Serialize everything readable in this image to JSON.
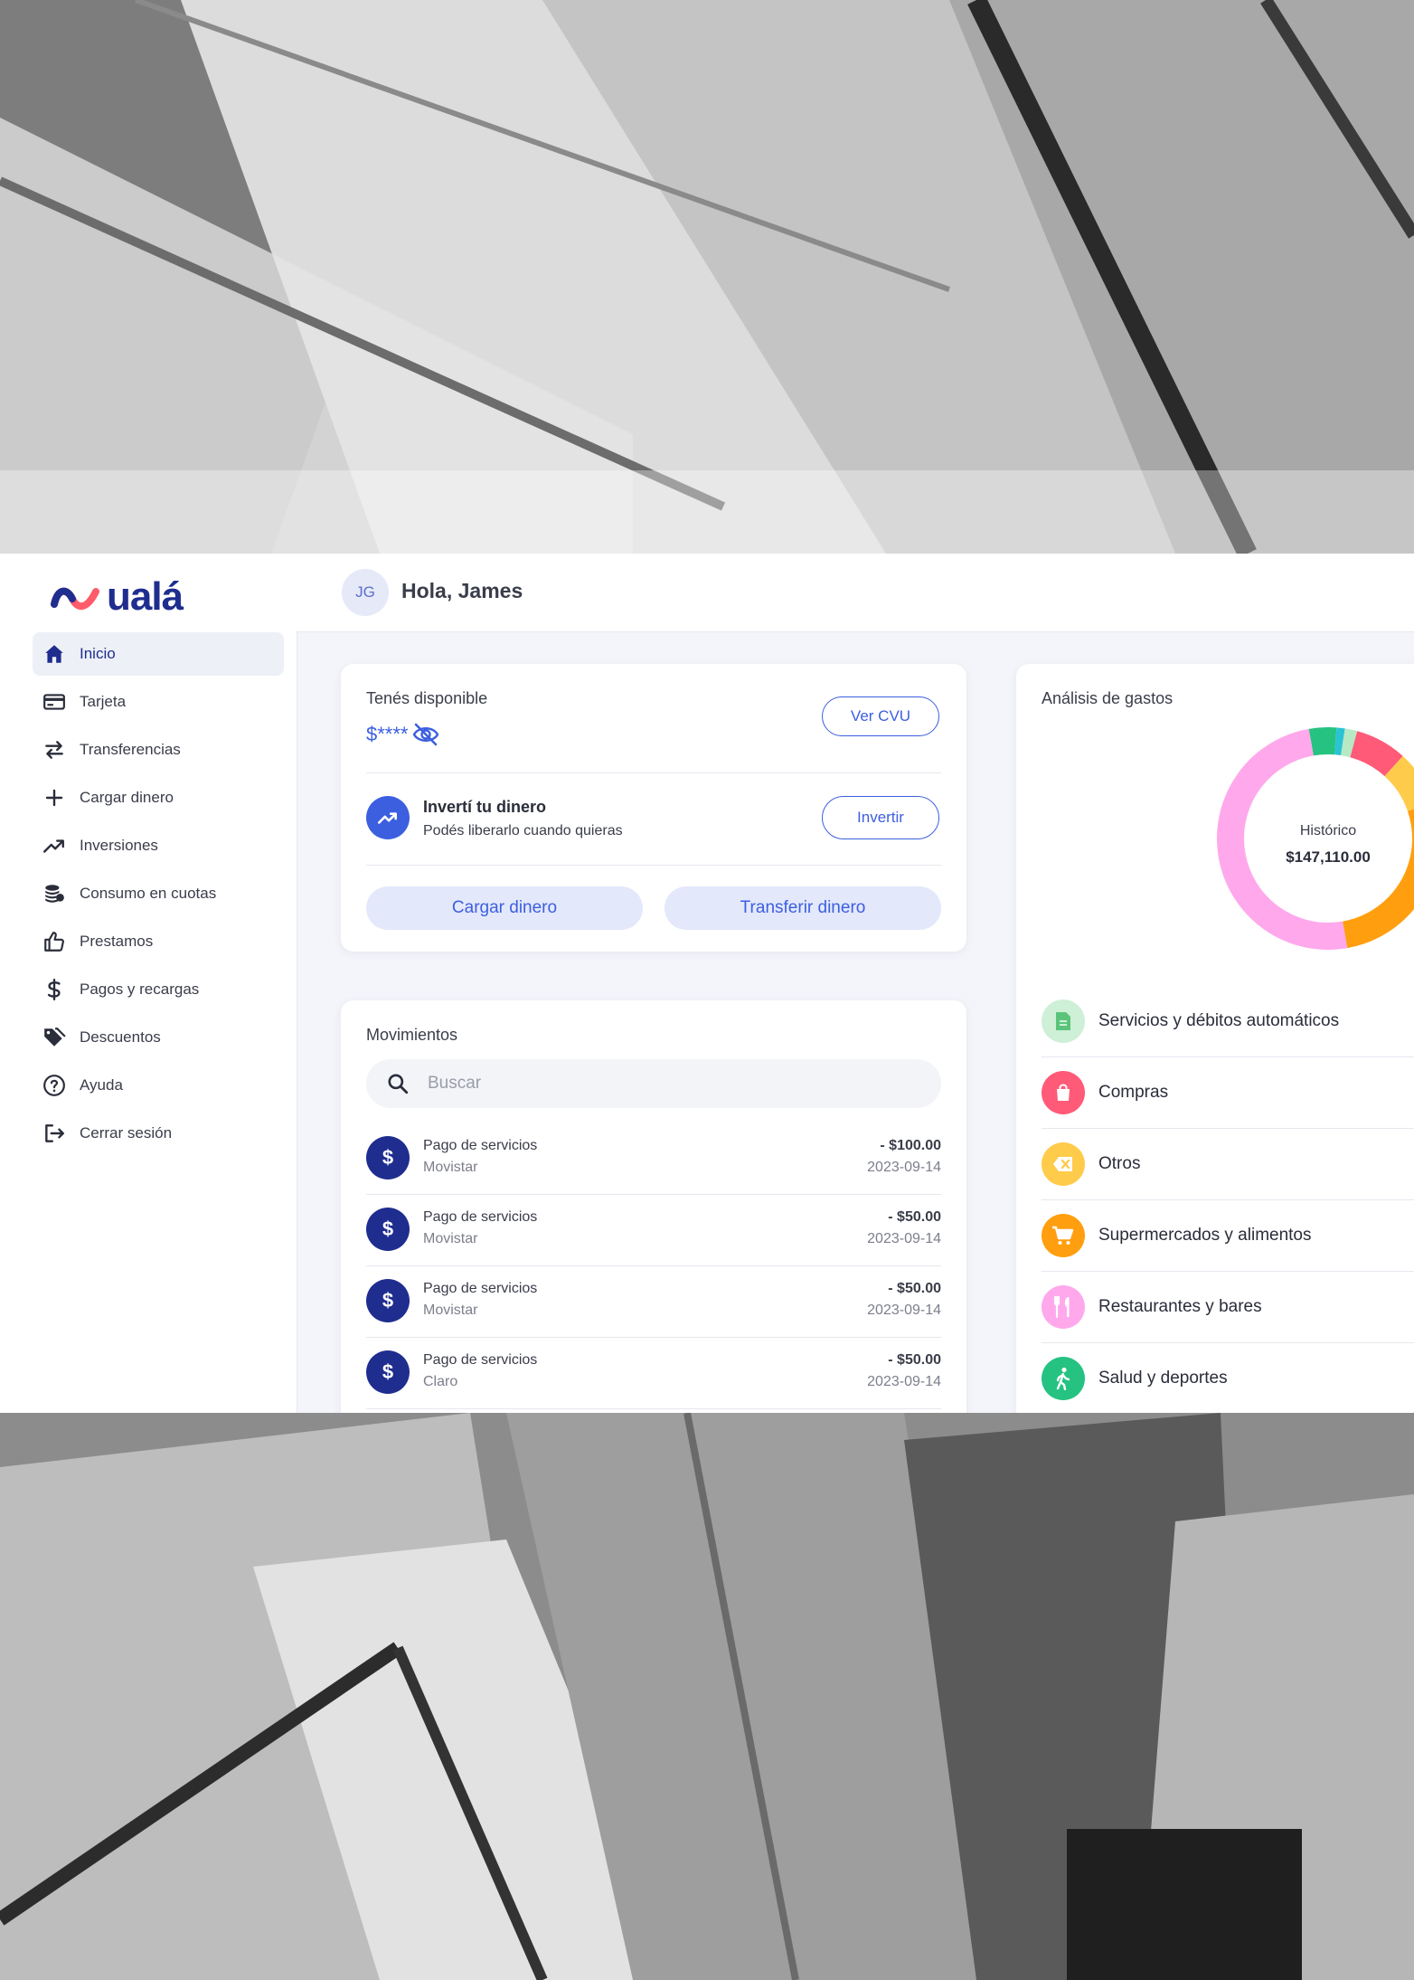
{
  "brand": {
    "name": "ualá",
    "color": "#1f2d8f",
    "accent": "#3c5fe0"
  },
  "sidebar": {
    "items": [
      {
        "label": "Inicio",
        "icon": "home-icon",
        "active": true
      },
      {
        "label": "Tarjeta",
        "icon": "card-icon"
      },
      {
        "label": "Transferencias",
        "icon": "transfer-icon"
      },
      {
        "label": "Cargar dinero",
        "icon": "plus-icon"
      },
      {
        "label": "Inversiones",
        "icon": "trend-icon"
      },
      {
        "label": "Consumo en cuotas",
        "icon": "coins-icon"
      },
      {
        "label": "Prestamos",
        "icon": "thumb-up-icon"
      },
      {
        "label": "Pagos y recargas",
        "icon": "dollar-icon"
      },
      {
        "label": "Descuentos",
        "icon": "tag-icon"
      },
      {
        "label": "Ayuda",
        "icon": "help-icon"
      },
      {
        "label": "Cerrar sesión",
        "icon": "logout-icon"
      }
    ]
  },
  "header": {
    "avatar_initials": "JG",
    "greeting": "Hola, James"
  },
  "balance": {
    "label": "Tenés disponible",
    "masked_amount": "$****",
    "ver_cvu": "Ver CVU",
    "invest_title": "Invertí tu dinero",
    "invest_subtitle": "Podés liberarlo cuando quieras",
    "invest_button": "Invertir",
    "load_button": "Cargar dinero",
    "transfer_button": "Transferir dinero"
  },
  "movements": {
    "title": "Movimientos",
    "search_placeholder": "Buscar",
    "items": [
      {
        "title": "Pago de servicios",
        "subtitle": "Movistar",
        "amount": "- $100.00",
        "date": "2023-09-14"
      },
      {
        "title": "Pago de servicios",
        "subtitle": "Movistar",
        "amount": "- $50.00",
        "date": "2023-09-14"
      },
      {
        "title": "Pago de servicios",
        "subtitle": "Movistar",
        "amount": "- $50.00",
        "date": "2023-09-14"
      },
      {
        "title": "Pago de servicios",
        "subtitle": "Claro",
        "amount": "- $50.00",
        "date": "2023-09-14"
      }
    ]
  },
  "analysis": {
    "title": "Análisis de gastos",
    "center_label": "Histórico",
    "center_value": "$147,110.00",
    "segments": [
      {
        "color": "#26c281",
        "fraction": 0.04
      },
      {
        "color": "#29c3d4",
        "fraction": 0.012
      },
      {
        "color": "#b6e9c4",
        "fraction": 0.018
      },
      {
        "color": "#ff5a78",
        "fraction": 0.075
      },
      {
        "color": "#ffcb4a",
        "fraction": 0.08
      },
      {
        "color": "#ff9f0f",
        "fraction": 0.275
      },
      {
        "color": "#ffa8ec",
        "fraction": 0.5
      }
    ],
    "categories": [
      {
        "label": "Servicios y débitos automáticos",
        "icon": "document-icon",
        "bg": "#cdf0d6",
        "fg": "#5cc47a"
      },
      {
        "label": "Compras",
        "icon": "shopping-bag-icon",
        "bg": "#ff5a78",
        "fg": "#ffffff"
      },
      {
        "label": "Otros",
        "icon": "tag-x-icon",
        "bg": "#ffcb4a",
        "fg": "#ffffff"
      },
      {
        "label": "Supermercados y alimentos",
        "icon": "cart-icon",
        "bg": "#ff9f0f",
        "fg": "#ffffff"
      },
      {
        "label": "Restaurantes y bares",
        "icon": "cutlery-icon",
        "bg": "#ffa8ec",
        "fg": "#ffffff"
      },
      {
        "label": "Salud y deportes",
        "icon": "walking-icon",
        "bg": "#26c281",
        "fg": "#ffffff"
      }
    ]
  }
}
